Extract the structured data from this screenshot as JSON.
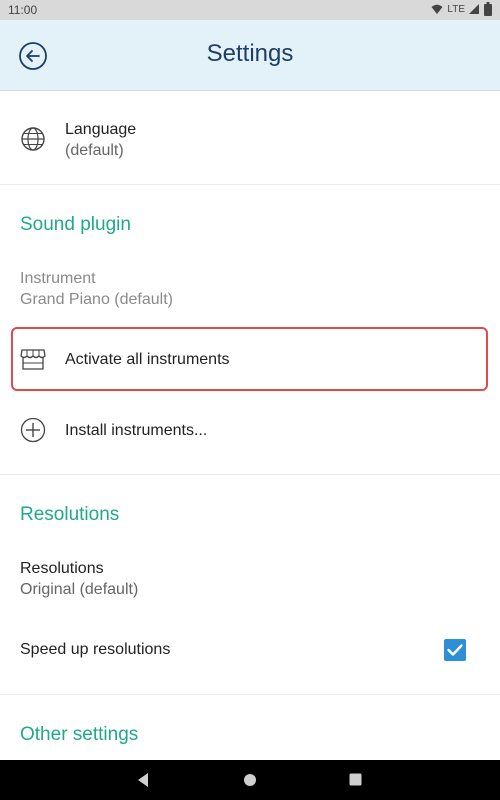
{
  "status": {
    "time": "11:00",
    "network": "LTE"
  },
  "header": {
    "title": "Settings"
  },
  "language": {
    "label": "Language",
    "value": "(default)"
  },
  "sound_plugin": {
    "header": "Sound plugin",
    "instrument_label": "Instrument",
    "instrument_value": "Grand Piano (default)",
    "activate_label": "Activate all instruments",
    "install_label": "Install instruments..."
  },
  "resolutions": {
    "header": "Resolutions",
    "label": "Resolutions",
    "value": "Original (default)",
    "speedup_label": "Speed up resolutions",
    "speedup_checked": true
  },
  "other": {
    "header": "Other settings"
  },
  "colors": {
    "accent": "#20a98a",
    "title": "#1d3e66",
    "highlight": "#e04a4a",
    "checkbox": "#2e8fd6"
  }
}
